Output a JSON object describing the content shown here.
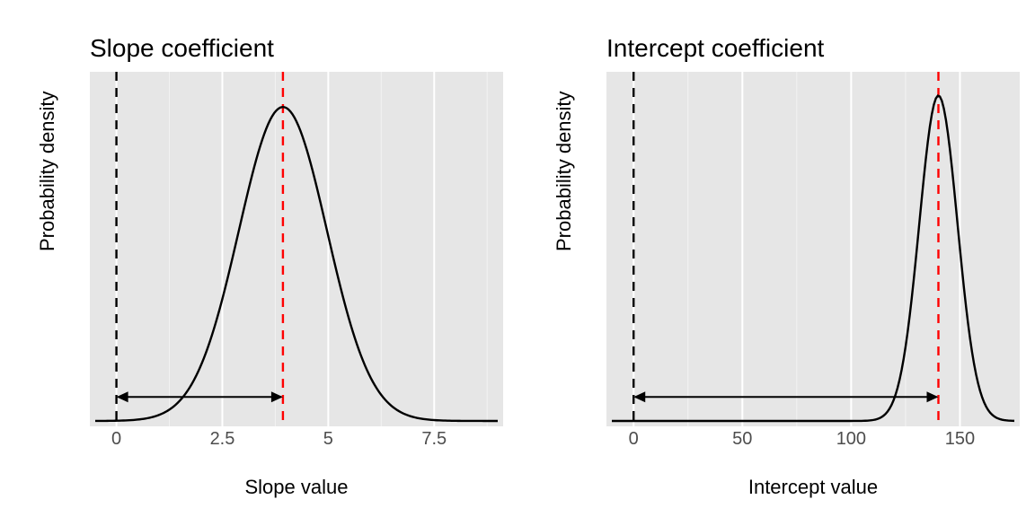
{
  "chart_data": [
    {
      "type": "line",
      "title": "Slope coefficient",
      "xlabel": "Slope value",
      "ylabel": "Probability density",
      "xlim": [
        -0.5,
        9.0
      ],
      "ylim": [
        0.0,
        0.42
      ],
      "x_ticks": [
        0.0,
        2.5,
        5.0,
        7.5
      ],
      "x_minor": [
        1.25,
        3.75,
        6.25,
        8.75
      ],
      "distribution": {
        "type": "normal",
        "mean": 3.93,
        "sd": 1.04
      },
      "null_value": 0.0,
      "arrow_y_frac": 0.07
    },
    {
      "type": "line",
      "title": "Intercept coefficient",
      "xlabel": "Intercept value",
      "ylabel": "Probability density",
      "xlim": [
        -10,
        175
      ],
      "ylim": [
        0.0,
        0.048
      ],
      "x_ticks": [
        0,
        50,
        100,
        150
      ],
      "x_minor": [
        25,
        75,
        125
      ],
      "distribution": {
        "type": "normal",
        "mean": 140.1,
        "sd": 8.78
      },
      "null_value": 0.0,
      "arrow_y_frac": 0.07
    }
  ],
  "left": {
    "title": "Slope coefficient",
    "ylabel": "Probability density",
    "xlabel": "Slope value"
  },
  "right": {
    "title": "Intercept coefficient",
    "ylabel": "Probability density",
    "xlabel": "Intercept value"
  }
}
